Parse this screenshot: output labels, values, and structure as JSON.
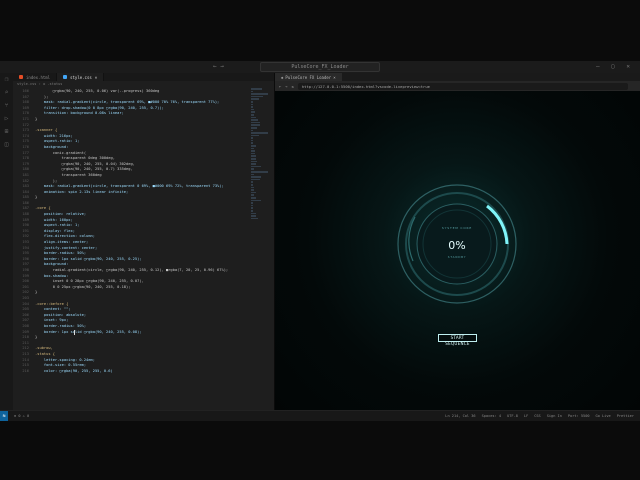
{
  "titlebar": {
    "search": "PulseCore_FX_Loader",
    "nav": "← →",
    "win": "— ▢ ✕"
  },
  "editor": {
    "tabs": [
      {
        "label": "index.html",
        "color": "#e44d26"
      },
      {
        "label": "style.css",
        "color": "#42a5f5"
      }
    ],
    "breadcrumb": "style.css › ⚙ .status",
    "lines": [
      {
        "n": "166",
        "t": "        ▢rgba(90, 240, 255, 0.06) var(--progress) 360deg"
      },
      {
        "n": "167",
        "t": "    );"
      },
      {
        "n": "168",
        "t": "    mask: radial-gradient(circle, transparent 69%, ■#000 70% 76%, transparent 77%);"
      },
      {
        "n": "169",
        "t": "    filter: drop-shadow(0 0 8px ▢rgba(90, 240, 255, 0.7));"
      },
      {
        "n": "170",
        "t": "    transition: background 0.08s linear;"
      },
      {
        "n": "171",
        "t": "}"
      },
      {
        "n": "172",
        "t": ""
      },
      {
        "n": "173",
        "t": ".scanner {"
      },
      {
        "n": "174",
        "t": "    width: 216px;"
      },
      {
        "n": "175",
        "t": "    aspect-ratio: 1;"
      },
      {
        "n": "176",
        "t": "    background:"
      },
      {
        "n": "177",
        "t": "        conic-gradient("
      },
      {
        "n": "178",
        "t": "            transparent 0deg 300deg,"
      },
      {
        "n": "179",
        "t": "            ▢rgba(90, 240, 255, 0.04) 302deg,"
      },
      {
        "n": "180",
        "t": "            ▢rgba(90, 240, 255, 0.7) 335deg,"
      },
      {
        "n": "181",
        "t": "            transparent 360deg"
      },
      {
        "n": "182",
        "t": "        );"
      },
      {
        "n": "183",
        "t": "    mask: radial-gradient(circle, transparent 0 69%, ■#000 69% 72%, transparent 73%);"
      },
      {
        "n": "184",
        "t": "    animation: spin 2.13s linear infinite;"
      },
      {
        "n": "185",
        "t": "}"
      },
      {
        "n": "186",
        "t": ""
      },
      {
        "n": "187",
        "t": ".core {"
      },
      {
        "n": "188",
        "t": "    position: relative;"
      },
      {
        "n": "189",
        "t": "    width: 160px;"
      },
      {
        "n": "190",
        "t": "    aspect-ratio: 1;"
      },
      {
        "n": "191",
        "t": "    display: flex;"
      },
      {
        "n": "192",
        "t": "    flex-direction: column;"
      },
      {
        "n": "193",
        "t": "    align-items: center;"
      },
      {
        "n": "194",
        "t": "    justify-content: center;"
      },
      {
        "n": "195",
        "t": "    border-radius: 50%;"
      },
      {
        "n": "196",
        "t": "    border: 1px solid ▢rgba(90, 240, 255, 0.25);"
      },
      {
        "n": "197",
        "t": "    background:"
      },
      {
        "n": "198",
        "t": "        radial-gradient(circle, ▢rgba(90, 240, 255, 0.12), ■rgba(7, 20, 25, 0.96) 67%);"
      },
      {
        "n": "199",
        "t": "    box-shadow:"
      },
      {
        "n": "200",
        "t": "        inset 0 0 28px ▢rgba(90, 240, 255, 0.07),"
      },
      {
        "n": "201",
        "t": "        0 0 25px ▢rgba(90, 240, 255, 0.18);"
      },
      {
        "n": "202",
        "t": "}"
      },
      {
        "n": "203",
        "t": ""
      },
      {
        "n": "204",
        "t": ".core::before {"
      },
      {
        "n": "205",
        "t": "    content: \"\";"
      },
      {
        "n": "206",
        "t": "    position: absolute;"
      },
      {
        "n": "207",
        "t": "    inset: 9px;"
      },
      {
        "n": "208",
        "t": "    border-radius: 50%;"
      },
      {
        "n": "209",
        "t": "    border: 1px solid ▢rgba(90, 240, 255, 0.08);"
      },
      {
        "n": "210",
        "t": "}"
      },
      {
        "n": "211",
        "t": ""
      },
      {
        "n": "212",
        "t": ".subrow,"
      },
      {
        "n": "213",
        "t": ".status {"
      },
      {
        "n": "214",
        "t": "    letter-spacing: 0.24em;"
      },
      {
        "n": "215",
        "t": "    font-size: 0.55rem;"
      },
      {
        "n": "216",
        "t": "    color: ▢rgba(90, 255, 255, 0.6)"
      }
    ]
  },
  "browser": {
    "tab": "PulseCore FX Loader",
    "url": "http://127.0.0.1:5500/index.html?vscode-livepreview=true",
    "loader": {
      "top_label": "SYSTEM CORE",
      "percent": "0%",
      "status": "STANDBY",
      "progress": 0.0
    },
    "start_button": "START SEQUENCE"
  },
  "statusbar": {
    "left": "⊗ 0 ⚠ 0",
    "pos": "Ln 214, Col 36",
    "spaces": "Spaces: 4",
    "enc": "UTF-8",
    "eol": "LF",
    "lang": "CSS",
    "signin": "Sign In",
    "port": "Port: 5500",
    "golive": "Go Live",
    "prettier": "Prettier"
  },
  "colors": {
    "accent": "#5af0ff",
    "bg": "#020707"
  }
}
